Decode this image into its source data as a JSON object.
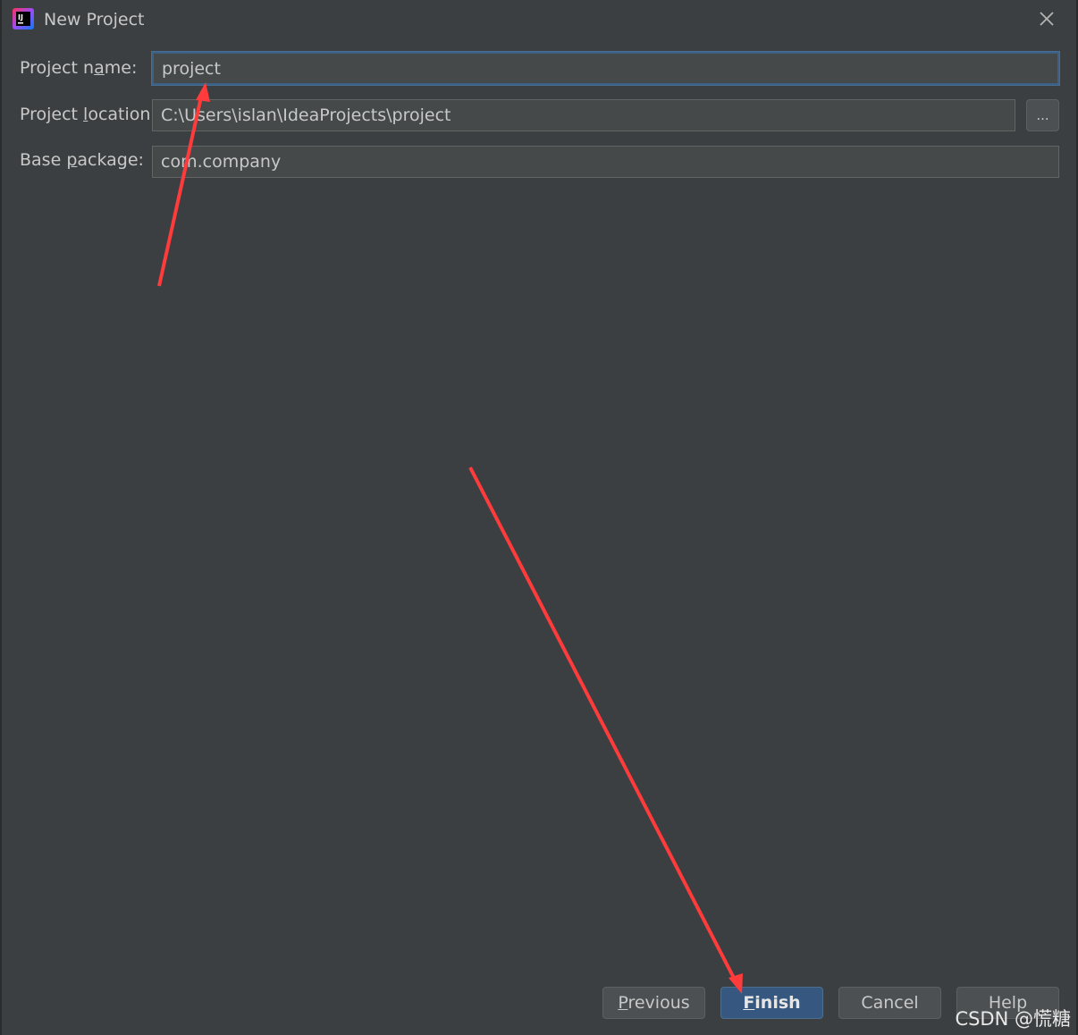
{
  "window": {
    "title": "New Project"
  },
  "form": {
    "project_name": {
      "label_pre": "Project n",
      "label_mn": "a",
      "label_post": "me:",
      "value": "project"
    },
    "project_location": {
      "label_pre": "Project ",
      "label_mn": "l",
      "label_post": "ocation:",
      "value": "C:\\Users\\islan\\IdeaProjects\\project",
      "browse_label": "..."
    },
    "base_package": {
      "label_pre": "Base ",
      "label_mn": "p",
      "label_post": "ackage:",
      "value": "com.company"
    }
  },
  "buttons": {
    "previous": {
      "mn": "P",
      "rest": "revious"
    },
    "finish": {
      "mn": "F",
      "rest": "inish"
    },
    "cancel": "Cancel",
    "help": "Help"
  },
  "watermark": "CSDN @慌糖",
  "colors": {
    "background": "#3c3f41",
    "field_bg": "#45494a",
    "focus_border": "#3d6185",
    "primary_button": "#365880",
    "annotation_arrow": "#ff3b3b"
  },
  "icons": {
    "app": "intellij-idea-icon",
    "close": "close-icon"
  }
}
